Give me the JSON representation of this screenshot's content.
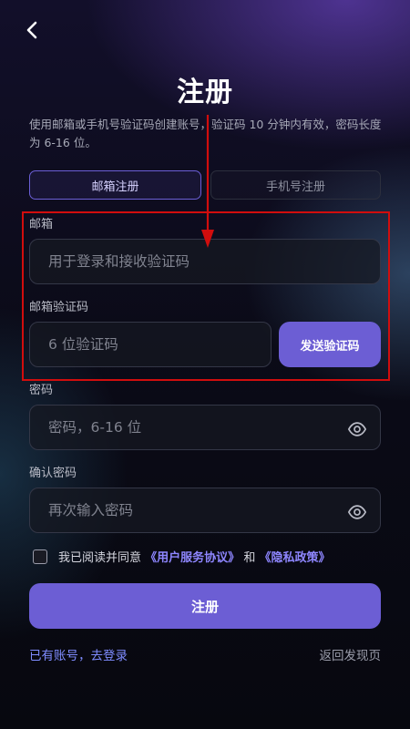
{
  "header": {
    "back_icon": "chevron-left-icon",
    "title": "注册",
    "subtitle": "使用邮箱或手机号验证码创建账号，验证码 10 分钟内有效，密码长度为 6-16 位。"
  },
  "tabs": [
    {
      "label": "邮箱注册",
      "active": true
    },
    {
      "label": "手机号注册",
      "active": false
    }
  ],
  "form": {
    "email": {
      "label": "邮箱",
      "value": "",
      "placeholder": "用于登录和接收验证码"
    },
    "code": {
      "label": "邮箱验证码",
      "value": "",
      "placeholder": "6 位验证码",
      "send_label": "发送验证码"
    },
    "password": {
      "label": "密码",
      "value": "",
      "placeholder": "密码，6-16 位",
      "icon": "eye-icon"
    },
    "confirm": {
      "label": "确认密码",
      "value": "",
      "placeholder": "再次输入密码",
      "icon": "eye-icon"
    },
    "agreement": {
      "checked": false,
      "prefix": "我已阅读并同意",
      "terms": "《用户服务协议》",
      "and": "和",
      "privacy": "《隐私政策》"
    },
    "submit_label": "注册"
  },
  "footer": {
    "login_link": "已有账号，去登录",
    "discover_link": "返回发现页"
  },
  "colors": {
    "accent": "#6c5ed4",
    "link": "#8e86ff",
    "highlight": "#d10d0d"
  }
}
